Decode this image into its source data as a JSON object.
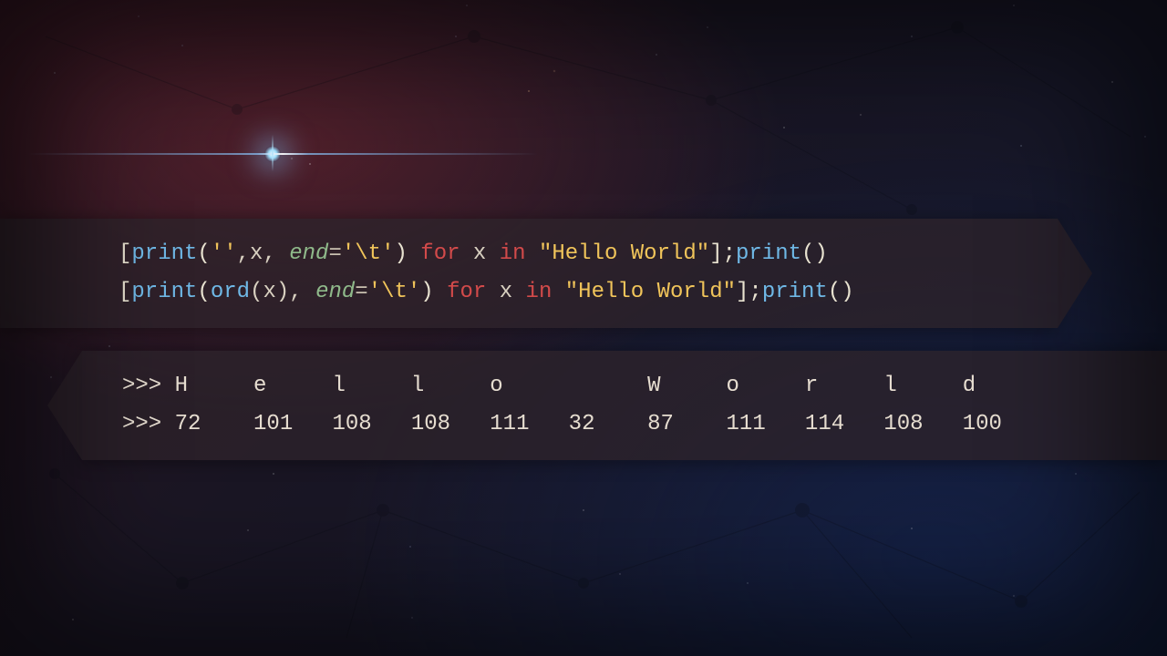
{
  "code": {
    "line1": {
      "open": "[",
      "fn1": "print",
      "paren1": "(",
      "str_empty": "''",
      "comma_x": ",x, ",
      "end_kw": "end",
      "eq": "=",
      "str_tab": "'\\t'",
      "paren1c": ") ",
      "for_kw": "for",
      "sp1": " x ",
      "in_kw": "in",
      "sp2": " ",
      "str_hello": "\"Hello World\"",
      "close": "];",
      "fn2": "print",
      "tail": "()"
    },
    "line2": {
      "open": "[",
      "fn1": "print",
      "paren1": "(",
      "ord_fn": "ord",
      "ord_open": "(x), ",
      "end_kw": "end",
      "eq": "=",
      "str_tab": "'\\t'",
      "paren1c": ") ",
      "for_kw": "for",
      "sp1": " x ",
      "in_kw": "in",
      "sp2": " ",
      "str_hello": "\"Hello World\"",
      "close": "];",
      "fn2": "print",
      "tail": "()"
    }
  },
  "output": {
    "prompt": ">>>",
    "chars": [
      "H",
      "e",
      "l",
      "l",
      "o",
      " ",
      "W",
      "o",
      "r",
      "l",
      "d"
    ],
    "codes": [
      72,
      101,
      108,
      108,
      111,
      32,
      87,
      111,
      114,
      108,
      100
    ]
  }
}
